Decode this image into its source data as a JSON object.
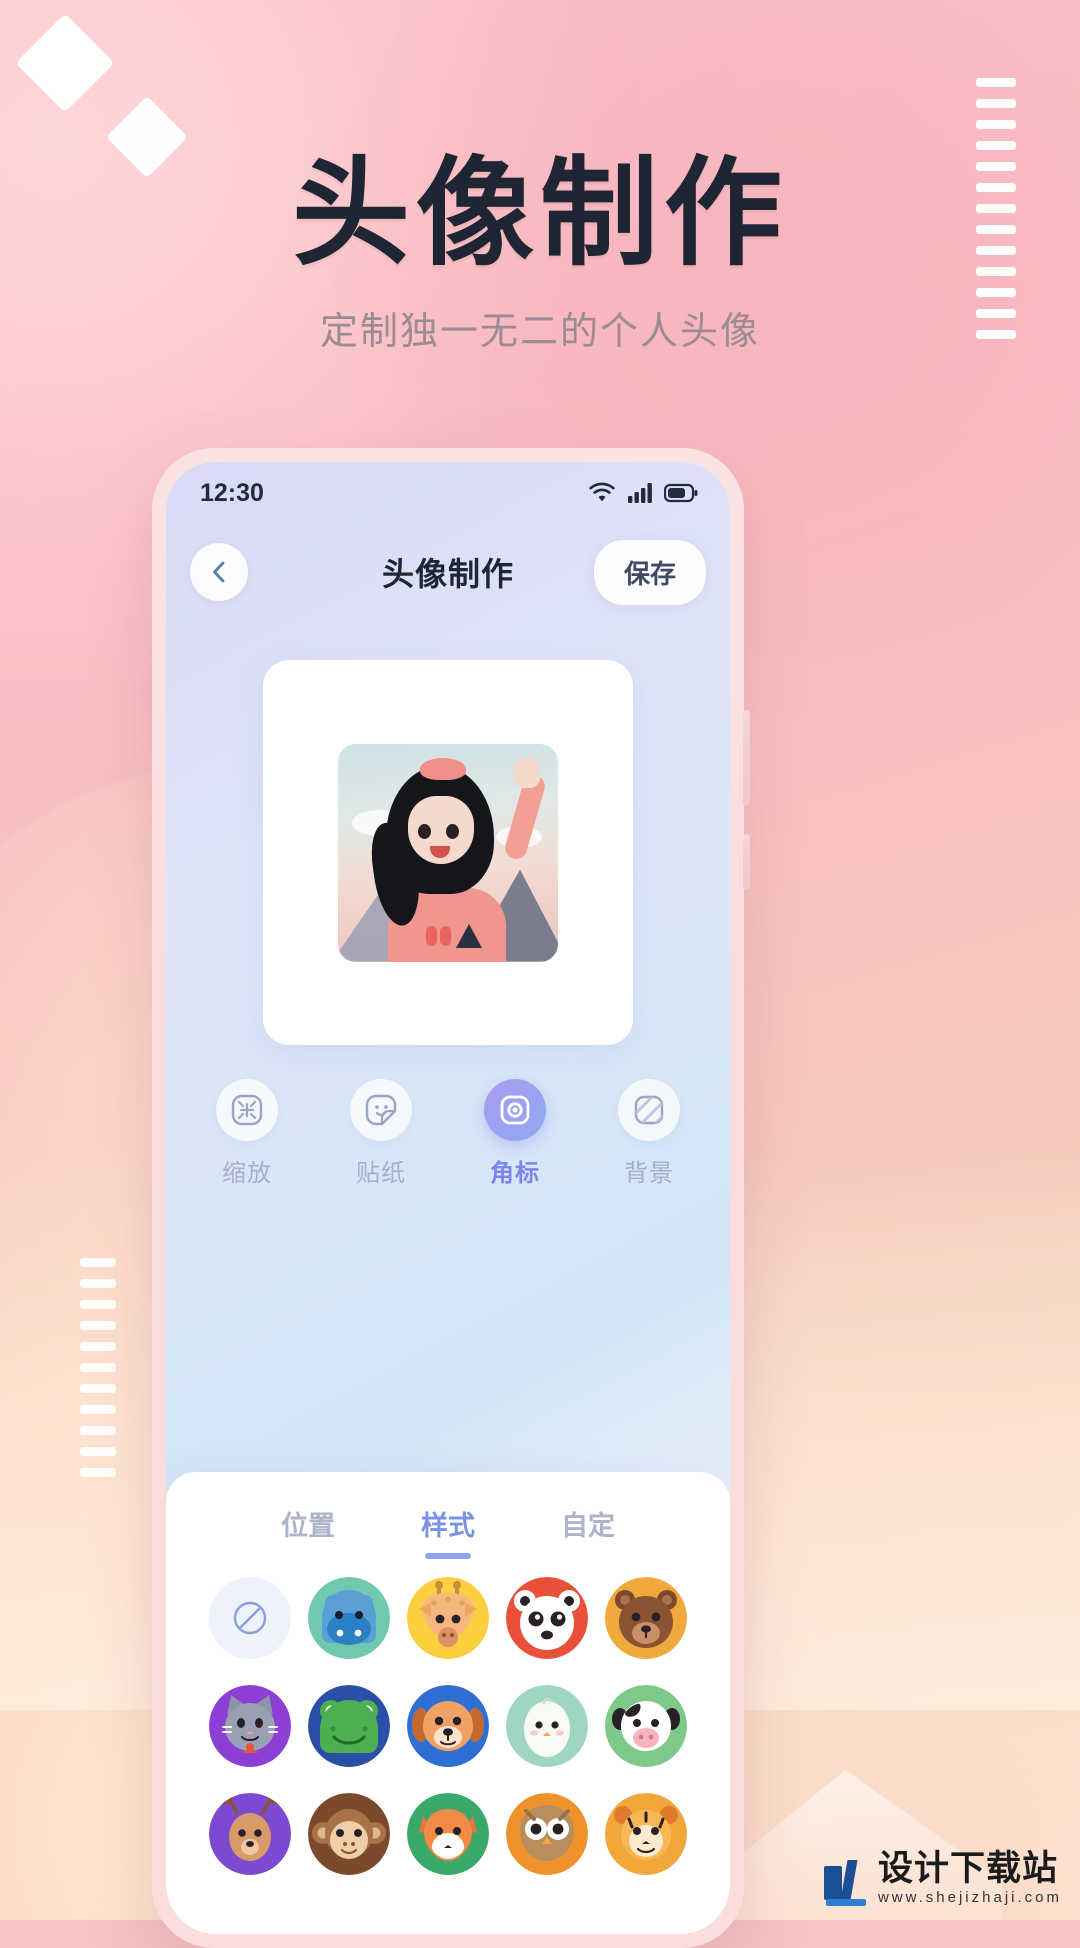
{
  "poster": {
    "title": "头像制作",
    "subtitle": "定制独一无二的个人头像"
  },
  "phone": {
    "statusbar": {
      "time": "12:30",
      "icons": [
        "wifi-icon",
        "signal-icon",
        "battery-icon"
      ]
    },
    "navbar": {
      "back_icon": "chevron-left-icon",
      "title": "头像制作",
      "save_label": "保存"
    },
    "tools": [
      {
        "label": "缩放",
        "icon": "scale-icon",
        "active": false
      },
      {
        "label": "贴纸",
        "icon": "sticker-icon",
        "active": false
      },
      {
        "label": "角标",
        "icon": "badge-icon",
        "active": true
      },
      {
        "label": "背景",
        "icon": "background-icon",
        "active": false
      }
    ],
    "tabs": [
      {
        "label": "位置",
        "active": false
      },
      {
        "label": "样式",
        "active": true
      },
      {
        "label": "自定",
        "active": false
      }
    ],
    "badge_options": [
      {
        "name": "none",
        "bg": "#eef2fa",
        "label": "无"
      },
      {
        "name": "hippo",
        "bg": "#6ec9b0",
        "label": "河马"
      },
      {
        "name": "giraffe",
        "bg": "#fbcf3e",
        "label": "长颈鹿"
      },
      {
        "name": "panda",
        "bg": "#e8503a",
        "label": "熊猫"
      },
      {
        "name": "bear",
        "bg": "#f0a93c",
        "label": "棕熊"
      },
      {
        "name": "cat",
        "bg": "#8b3fd4",
        "label": "猫"
      },
      {
        "name": "frog",
        "bg": "#2a4fa8",
        "label": "青蛙"
      },
      {
        "name": "dog",
        "bg": "#2e6fd4",
        "label": "小狗"
      },
      {
        "name": "chick",
        "bg": "#9fd6c2",
        "label": "小鸡"
      },
      {
        "name": "cow",
        "bg": "#7ec88a",
        "label": "奶牛"
      },
      {
        "name": "deer",
        "bg": "#7c4ad0",
        "label": "小鹿"
      },
      {
        "name": "monkey",
        "bg": "#7b4a2d",
        "label": "猴子"
      },
      {
        "name": "fox",
        "bg": "#3aa86a",
        "label": "狐狸"
      },
      {
        "name": "owl",
        "bg": "#f0922c",
        "label": "猫头鹰"
      },
      {
        "name": "tiger",
        "bg": "#f2a73b",
        "label": "老虎"
      }
    ]
  },
  "watermark": {
    "name": "设计下载站",
    "url": "www.shejizhaji.com"
  },
  "colors": {
    "poster_bg_pink": "#f8c3c7",
    "poster_bg_peach": "#fae3d1",
    "title_dark": "#1e2633",
    "subtitle_gray": "#9b8b94",
    "accent_blue": "#7b93e6",
    "accent_purple": "#8a84ec"
  }
}
